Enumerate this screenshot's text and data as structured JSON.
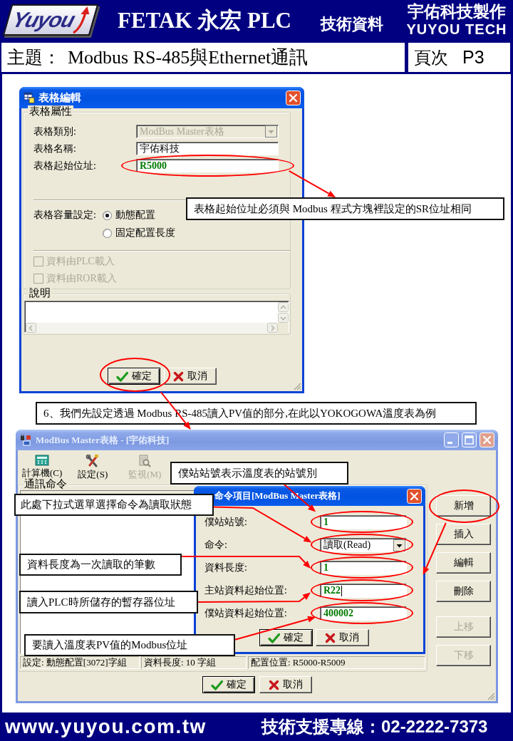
{
  "header": {
    "logo": "Yuyou",
    "title": "FETAK 永宏 PLC",
    "doc_type": "技術資料",
    "maker": "宇佑科技製作",
    "maker_en": "YUYOU TECH"
  },
  "subject_bar": {
    "label": "主題：",
    "subject": "Modbus RS-485與Ethernet通訊",
    "page_label": "頁次",
    "page": "P3"
  },
  "table_dialog": {
    "title": "表格編輯",
    "properties_group": "表格屬性",
    "fields": [
      {
        "label": "表格類別:",
        "kind": "combo",
        "value": "ModBus Master表格",
        "disabled": true,
        "circled": false
      },
      {
        "label": "表格名稱:",
        "kind": "text",
        "value": "宇佑科技",
        "disabled": false,
        "circled": false
      },
      {
        "label": "表格起始位址:",
        "kind": "address",
        "value": "R5000",
        "disabled": false,
        "circled": true
      }
    ],
    "capacity_label": "表格容量設定:",
    "capacity_options": [
      {
        "label": "動態配置",
        "selected": true
      },
      {
        "label": "固定配置長度",
        "selected": false
      }
    ],
    "load_options": [
      {
        "label": "資料由PLC載入",
        "checked": false,
        "disabled": true
      },
      {
        "label": "資料由ROR載入",
        "checked": false,
        "disabled": true
      }
    ],
    "note_group": "說明",
    "buttons": [
      {
        "label": "確定",
        "kind": "ok",
        "circled": true
      },
      {
        "label": "取消",
        "kind": "cancel",
        "circled": false
      }
    ]
  },
  "master_window": {
    "title": "ModBus Master表格 - [宇佑科技]",
    "toolbar": [
      {
        "label": "計算機(C)",
        "kind": "calculator",
        "disabled": false
      },
      {
        "label": "設定(S)",
        "kind": "settings",
        "disabled": false
      },
      {
        "label": "監視(M)",
        "kind": "monitor",
        "disabled": true
      }
    ],
    "commands_group": "通訊命令",
    "status": [
      "設定: 動態配置[3072]字組",
      "資料長度: 10 字組",
      "配置位置: R5000-R5009"
    ],
    "side_buttons": [
      {
        "label": "新增",
        "disabled": false,
        "circled": true
      },
      {
        "label": "插入",
        "disabled": false,
        "circled": false
      },
      {
        "label": "編輯",
        "disabled": false,
        "circled": false
      },
      {
        "label": "刪除",
        "disabled": false,
        "circled": false
      },
      {
        "label": "上移",
        "disabled": true,
        "circled": false
      },
      {
        "label": "下移",
        "disabled": true,
        "circled": false
      }
    ],
    "buttons": [
      {
        "label": "確定",
        "kind": "ok"
      },
      {
        "label": "取消",
        "kind": "cancel"
      }
    ]
  },
  "command_dialog": {
    "title": "命令項目[ModBus Master表格]",
    "fields": [
      {
        "label": "僕站站號:",
        "kind": "address",
        "value": "1",
        "circled": true,
        "focused": false
      },
      {
        "label": "命令:",
        "kind": "combo",
        "value": "讀取(Read)",
        "circled": true,
        "focused": false
      },
      {
        "label": "資料長度:",
        "kind": "address",
        "value": "1",
        "circled": true,
        "focused": false
      },
      {
        "label": "主站資料起始位置:",
        "kind": "address",
        "value": "R22",
        "circled": true,
        "focused": true
      },
      {
        "label": "僕站資料起始位置:",
        "kind": "address",
        "value": "400002",
        "circled": true,
        "focused": false
      }
    ],
    "buttons": [
      {
        "label": "確定",
        "kind": "ok"
      },
      {
        "label": "取消",
        "kind": "cancel"
      }
    ]
  },
  "callouts": [
    {
      "text": "表格起始位址必須與 Modbus 程式方塊裡設定的SR位址相同"
    },
    {
      "text": "6、我們先設定透過 Modbus RS-485讀入PV值的部分,在此以YOKOGOWA溫度表為例"
    },
    {
      "text": "僕站站號表示溫度表的站號別"
    },
    {
      "text": "此處下拉式選單選擇命令為讀取狀態"
    },
    {
      "text": "資料長度為一次讀取的筆數"
    },
    {
      "text": "讀入PLC時所儲存的暫存器位址"
    },
    {
      "text": "要讀入溫度表PV值的Modbus位址"
    }
  ],
  "footer": {
    "website": "www.yuyou.com.tw",
    "hotline": "技術支援專線：02-2222-7373"
  }
}
